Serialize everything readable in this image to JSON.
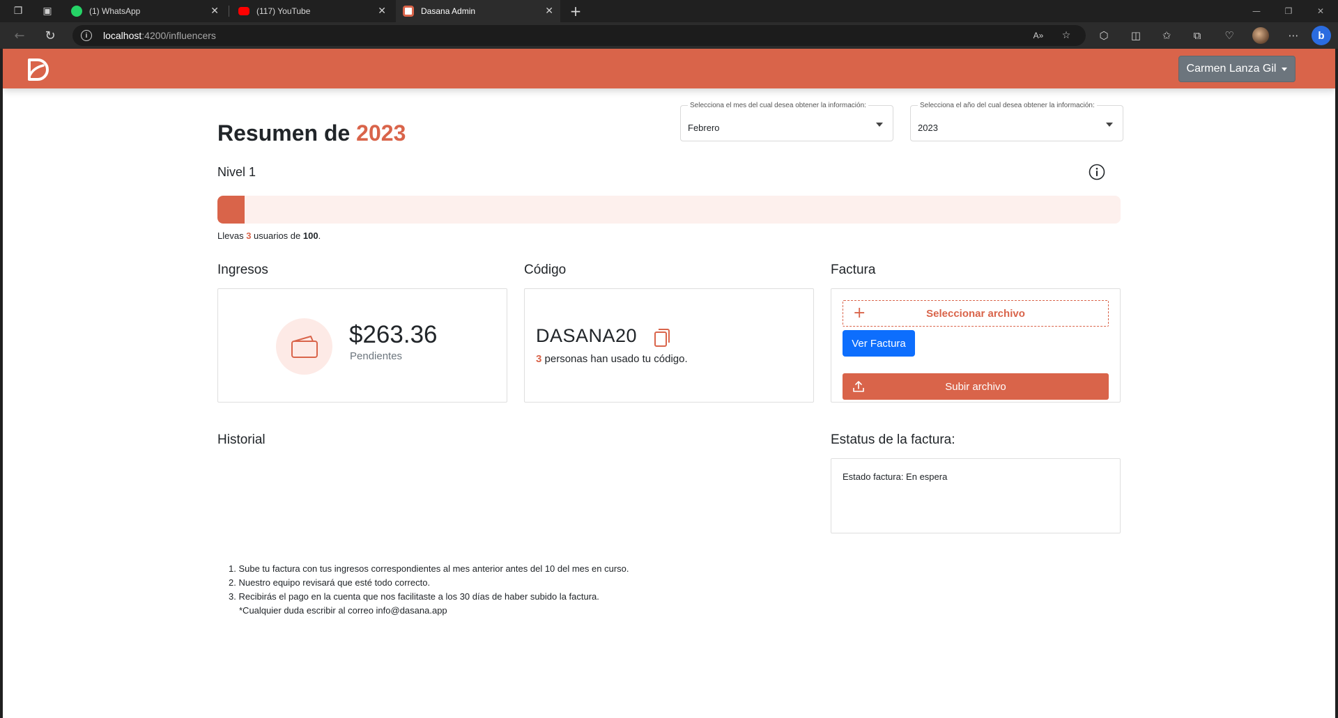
{
  "browser": {
    "tabs": [
      {
        "title": "(1) WhatsApp",
        "icon": "whatsapp-icon",
        "color": "#25d366"
      },
      {
        "title": "(117) YouTube",
        "icon": "youtube-icon",
        "color": "#ff0000"
      },
      {
        "title": "Dasana Admin",
        "icon": "dasana-icon",
        "color": "#d9644a"
      }
    ],
    "url_host": "localhost",
    "url_path": ":4200/influencers"
  },
  "header": {
    "brand_color": "#d9644a",
    "user_name": "Carmen Lanza Gil"
  },
  "summary": {
    "title_prefix": "Resumen de",
    "year": "2023"
  },
  "filters": {
    "month": {
      "label": "Selecciona el mes del cual desea obtener la información:",
      "value": "Febrero"
    },
    "year": {
      "label": "Selecciona el año del cual desea obtener la información:",
      "value": "2023"
    }
  },
  "level": {
    "title": "Nivel 1",
    "current": 3,
    "goal": 100,
    "progress_fraction": 0.03,
    "text_before": "Llevas ",
    "current_label": "3",
    "text_middle": " usuarios de ",
    "goal_label": "100",
    "text_after": "."
  },
  "income": {
    "title": "Ingresos",
    "amount": "$263.36",
    "status": "Pendientes"
  },
  "code": {
    "title": "Código",
    "value": "DASANA20",
    "usage_count": "3",
    "usage_text": " personas han usado tu código."
  },
  "invoice": {
    "title": "Factura",
    "select_label": "Seleccionar archivo",
    "view_label": "Ver Factura",
    "upload_label": "Subir archivo"
  },
  "history": {
    "title": "Historial"
  },
  "invoice_status": {
    "title": "Estatus de la factura:",
    "text": "Estado factura: En espera"
  },
  "steps": {
    "items": [
      "1. Sube tu factura con tus ingresos correspondientes al mes anterior antes del 10 del mes en curso.",
      "2. Nuestro equipo revisará que esté todo correcto.",
      "3. Recibirás el pago en la cuenta que nos facilitaste a los 30 días de haber subido la factura."
    ],
    "note": "*Cualquier duda escribir al correo info@dasana.app"
  }
}
